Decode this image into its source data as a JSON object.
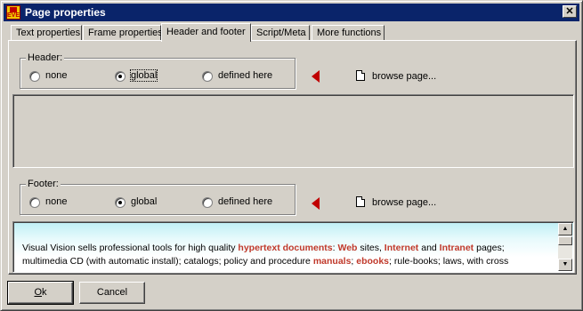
{
  "window": {
    "title": "Page properties",
    "app_icon_label": "EVE"
  },
  "tabs": [
    {
      "label": "Text properties"
    },
    {
      "label": "Frame properties"
    },
    {
      "label": "Header and footer"
    },
    {
      "label": "Script/Meta"
    },
    {
      "label": "More functions"
    }
  ],
  "header": {
    "group_label": "Header:",
    "options": [
      {
        "label": "none",
        "selected": false
      },
      {
        "label": "global",
        "selected": true
      },
      {
        "label": "defined here",
        "selected": false
      }
    ],
    "browse_label": "browse page..."
  },
  "footer": {
    "group_label": "Footer:",
    "options": [
      {
        "label": "none",
        "selected": false
      },
      {
        "label": "global",
        "selected": true
      },
      {
        "label": "defined here",
        "selected": false
      }
    ],
    "browse_label": "browse page...",
    "preview": {
      "t1": "Visual Vision sells professional tools for high quality ",
      "h1": "hypertext documents",
      "t2": ": ",
      "h2": "Web",
      "t3": " sites, ",
      "h3": "Internet",
      "t4": " and ",
      "h4": "Intranet",
      "t5": " pages; multimedia CD (with automatic install); catalogs; policy and procedure ",
      "h5": "manuals",
      "t6": "; ",
      "h6": "ebooks",
      "t7": "; rule-books; laws, with cross"
    }
  },
  "buttons": {
    "ok_hotkey": "O",
    "ok_rest": "k",
    "cancel": "Cancel"
  },
  "icons": {
    "arrow": "left-triangle-red",
    "page": "document-icon"
  },
  "colors": {
    "titlebar": "#0a246a",
    "accent_red": "#c00000",
    "highlight_text": "#c0392b"
  }
}
